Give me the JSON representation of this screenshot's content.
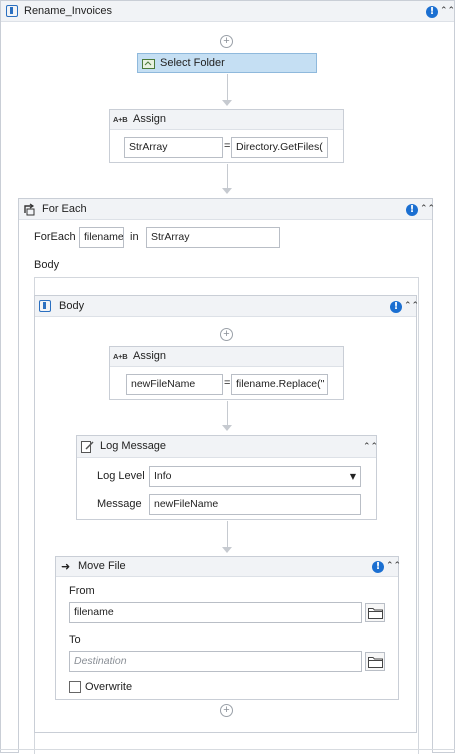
{
  "workflow": {
    "title": "Rename_Invoices"
  },
  "select_folder": {
    "label": "Select Folder"
  },
  "assign1": {
    "title": "Assign",
    "to": "StrArray",
    "eq": "=",
    "value": "Directory.GetFiles("
  },
  "foreach": {
    "title": "For Each",
    "foreach_label": "ForEach",
    "item": "filename",
    "in_label": "in",
    "collection": "StrArray",
    "body_label": "Body"
  },
  "body": {
    "title": "Body"
  },
  "assign2": {
    "title": "Assign",
    "to": "newFileName",
    "eq": "=",
    "value": "filename.Replace(\""
  },
  "log": {
    "title": "Log Message",
    "level_label": "Log Level",
    "level_value": "Info",
    "message_label": "Message",
    "message_value": "newFileName"
  },
  "move": {
    "title": "Move File",
    "from_label": "From",
    "from_value": "filename",
    "to_label": "To",
    "to_placeholder": "Destination",
    "overwrite_label": "Overwrite"
  },
  "icons": {
    "warning": "!",
    "collapse": "⌃⌃",
    "plus": "+",
    "assign_badge": "A+B",
    "dropdown_arrow": "▼"
  }
}
